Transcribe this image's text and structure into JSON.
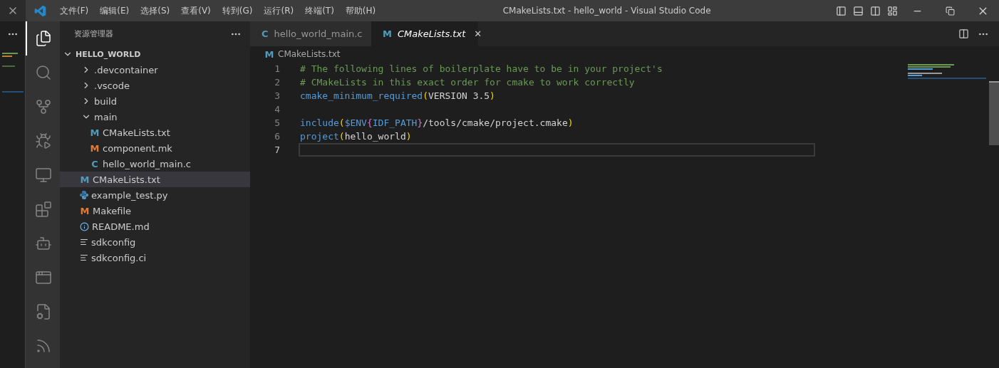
{
  "window": {
    "title": "CMakeLists.txt - hello_world - Visual Studio Code"
  },
  "menu": [
    "文件(F)",
    "编辑(E)",
    "选择(S)",
    "查看(V)",
    "转到(G)",
    "运行(R)",
    "终端(T)",
    "帮助(H)"
  ],
  "activity_bar": [
    {
      "kind": "explorer",
      "selected": true
    },
    {
      "kind": "search",
      "selected": false
    },
    {
      "kind": "source-control",
      "selected": false
    },
    {
      "kind": "run-debug",
      "selected": false
    },
    {
      "kind": "remote",
      "selected": false
    },
    {
      "kind": "extensions",
      "selected": false
    },
    {
      "kind": "platformio",
      "selected": false
    },
    {
      "kind": "preview",
      "selected": false
    },
    {
      "kind": "cpp-config",
      "selected": false
    },
    {
      "kind": "espressif",
      "selected": false
    }
  ],
  "sidebar": {
    "title": "资源管理器",
    "root": {
      "label": "HELLO_WORLD",
      "expanded": true,
      "children": [
        {
          "label": ".devcontainer",
          "kind": "folder",
          "expanded": false,
          "selected": false
        },
        {
          "label": ".vscode",
          "kind": "folder",
          "expanded": false,
          "selected": false
        },
        {
          "label": "build",
          "kind": "folder",
          "expanded": false,
          "selected": false
        },
        {
          "label": "main",
          "kind": "folder",
          "expanded": true,
          "selected": false,
          "children": [
            {
              "label": "CMakeLists.txt",
              "kind": "file",
              "icon": {
                "kind": "glyph",
                "text": "M",
                "color": "#519aba"
              },
              "selected": false
            },
            {
              "label": "component.mk",
              "kind": "file",
              "icon": {
                "kind": "glyph",
                "text": "M",
                "color": "#e37933"
              },
              "selected": false
            },
            {
              "label": "hello_world_main.c",
              "kind": "file",
              "icon": {
                "kind": "glyph",
                "text": "C",
                "color": "#519aba"
              },
              "selected": false
            }
          ]
        },
        {
          "label": "CMakeLists.txt",
          "kind": "file",
          "icon": {
            "kind": "glyph",
            "text": "M",
            "color": "#519aba"
          },
          "selected": true
        },
        {
          "label": "example_test.py",
          "kind": "file",
          "icon": {
            "kind": "python"
          },
          "selected": false
        },
        {
          "label": "Makefile",
          "kind": "file",
          "icon": {
            "kind": "glyph",
            "text": "M",
            "color": "#e37933"
          },
          "selected": false
        },
        {
          "label": "README.md",
          "kind": "file",
          "icon": {
            "kind": "info"
          },
          "selected": false
        },
        {
          "label": "sdkconfig",
          "kind": "file",
          "icon": {
            "kind": "lines"
          },
          "selected": false
        },
        {
          "label": "sdkconfig.ci",
          "kind": "file",
          "icon": {
            "kind": "lines"
          },
          "selected": false
        }
      ]
    }
  },
  "tabs": [
    {
      "label": "hello_world_main.c",
      "glyph": "C",
      "selected": false,
      "preview": false
    },
    {
      "label": "CMakeLists.txt",
      "glyph": "M",
      "selected": true,
      "preview": true,
      "close": "✕"
    }
  ],
  "breadcrumb": {
    "glyph": "M",
    "label": "CMakeLists.txt"
  },
  "code": {
    "lines": [
      {
        "number": "1",
        "tokens": [
          {
            "kind": "comment",
            "text": "# The following lines of boilerplate have to be in your project's"
          }
        ]
      },
      {
        "number": "2",
        "tokens": [
          {
            "kind": "comment",
            "text": "# CMakeLists in this exact order for cmake to work correctly"
          }
        ]
      },
      {
        "number": "3",
        "tokens": [
          {
            "kind": "command",
            "text": "cmake_minimum_required"
          },
          {
            "kind": "paren",
            "text": "("
          },
          {
            "kind": "text",
            "text": "VERSION 3.5"
          },
          {
            "kind": "paren",
            "text": ")"
          }
        ]
      },
      {
        "number": "4"
      },
      {
        "number": "5",
        "tokens": [
          {
            "kind": "command",
            "text": "include"
          },
          {
            "kind": "paren",
            "text": "("
          },
          {
            "kind": "variable",
            "text": "$ENV"
          },
          {
            "kind": "brace",
            "text": "{"
          },
          {
            "kind": "variable",
            "text": "IDF_PATH"
          },
          {
            "kind": "brace",
            "text": "}"
          },
          {
            "kind": "text",
            "text": "/tools/cmake/project.cmake"
          },
          {
            "kind": "paren",
            "text": ")"
          }
        ]
      },
      {
        "number": "6",
        "tokens": [
          {
            "kind": "command",
            "text": "project"
          },
          {
            "kind": "paren",
            "text": "("
          },
          {
            "kind": "text",
            "text": "hello_world"
          },
          {
            "kind": "paren",
            "text": ")"
          }
        ]
      },
      {
        "number": "7",
        "current": true
      }
    ]
  }
}
